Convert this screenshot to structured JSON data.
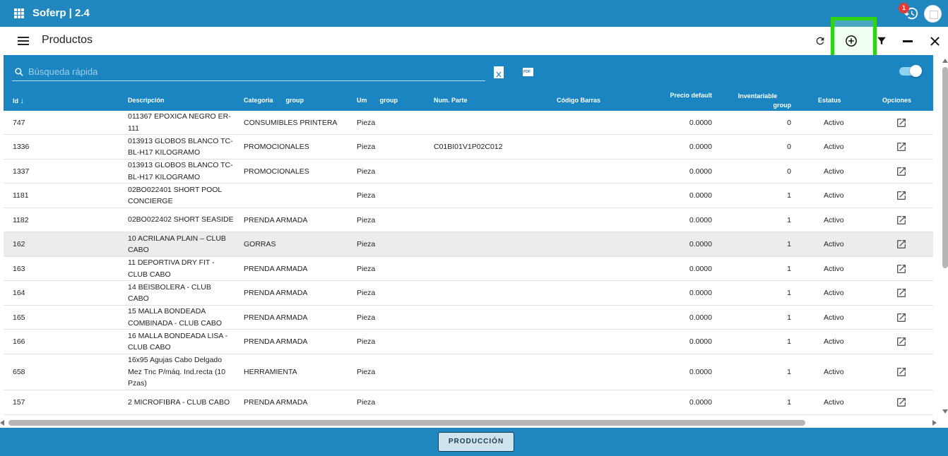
{
  "app": {
    "title": "Soferp | 2.4",
    "notification_count": "1"
  },
  "toolbar": {
    "title": "Productos",
    "icons": [
      "refresh-icon",
      "add-circle-icon",
      "filter-icon",
      "minimize-icon",
      "close-icon"
    ]
  },
  "grid": {
    "search_placeholder": "Búsqueda rápida",
    "export_icons": [
      "excel-icon",
      "pdf-icon"
    ],
    "pdf_label": "PDF",
    "columns": {
      "id": "Id",
      "descripcion": "Descripción",
      "categoria": "Categoria",
      "categoria_group": "group",
      "um": "Um",
      "um_group": "group",
      "num_parte": "Num. Parte",
      "codigo_barras": "Código Barras",
      "precio": "Precio default",
      "inventariable": "Inventariable",
      "inventariable_group": "group",
      "estatus": "Estatus",
      "opciones": "Opciones"
    },
    "rows": [
      {
        "id": "747",
        "desc": "011367 EPOXICA NEGRO ER-111",
        "cat": "CONSUMIBLES PRINTERA",
        "um": "Pieza",
        "part": "",
        "price": "0.0000",
        "inv": "0",
        "status": "Activo"
      },
      {
        "id": "1336",
        "desc": "013913 GLOBOS BLANCO TC-BL-H17 KILOGRAMO",
        "cat": "PROMOCIONALES",
        "um": "Pieza",
        "part": "C01BI01V1P02C012",
        "price": "0.0000",
        "inv": "0",
        "status": "Activo"
      },
      {
        "id": "1337",
        "desc": "013913 GLOBOS BLANCO TC-BL-H17 KILOGRAMO",
        "cat": "PROMOCIONALES",
        "um": "Pieza",
        "part": "",
        "price": "0.0000",
        "inv": "0",
        "status": "Activo"
      },
      {
        "id": "1181",
        "desc": "02BO022401 SHORT POOL CONCIERGE",
        "cat": "",
        "um": "Pieza",
        "part": "",
        "price": "0.0000",
        "inv": "1",
        "status": "Activo"
      },
      {
        "id": "1182",
        "desc": "02BO022402 SHORT SEASIDE",
        "cat": "PRENDA ARMADA",
        "um": "Pieza",
        "part": "",
        "price": "0.0000",
        "inv": "1",
        "status": "Activo"
      },
      {
        "id": "162",
        "desc": "10 ACRILANA PLAIN – CLUB CABO",
        "cat": "GORRAS",
        "um": "Pieza",
        "part": "",
        "price": "0.0000",
        "inv": "1",
        "status": "Activo"
      },
      {
        "id": "163",
        "desc": "11 DEPORTIVA DRY FIT - CLUB CABO",
        "cat": "PRENDA ARMADA",
        "um": "Pieza",
        "part": "",
        "price": "0.0000",
        "inv": "1",
        "status": "Activo"
      },
      {
        "id": "164",
        "desc": "14 BEISBOLERA - CLUB CABO",
        "cat": "PRENDA ARMADA",
        "um": "Pieza",
        "part": "",
        "price": "0.0000",
        "inv": "1",
        "status": "Activo"
      },
      {
        "id": "165",
        "desc": "15 MALLA BONDEADA COMBINADA - CLUB CABO",
        "cat": "PRENDA ARMADA",
        "um": "Pieza",
        "part": "",
        "price": "0.0000",
        "inv": "1",
        "status": "Activo"
      },
      {
        "id": "166",
        "desc": "16 MALLA BONDEADA LISA - CLUB CABO",
        "cat": "PRENDA ARMADA",
        "um": "Pieza",
        "part": "",
        "price": "0.0000",
        "inv": "1",
        "status": "Activo"
      },
      {
        "id": "658",
        "desc": "16x95 Agujas Cabo Delgado Mez Tnc P/máq. Ind.recta (10 Pzas)",
        "cat": "HERRAMIENTA",
        "um": "Pieza",
        "part": "",
        "price": "0.0000",
        "inv": "1",
        "status": "Activo"
      },
      {
        "id": "157",
        "desc": "2 MICROFIBRA - CLUB CABO",
        "cat": "PRENDA ARMADA",
        "um": "Pieza",
        "part": "",
        "price": "0.0000",
        "inv": "1",
        "status": "Activo"
      }
    ]
  },
  "footer": {
    "environment_label": "PRODUCCIÓN"
  },
  "colors": {
    "header_blue": "#2188bf",
    "grid_header_blue": "#1a85c1",
    "highlight_green": "#2ed316"
  }
}
